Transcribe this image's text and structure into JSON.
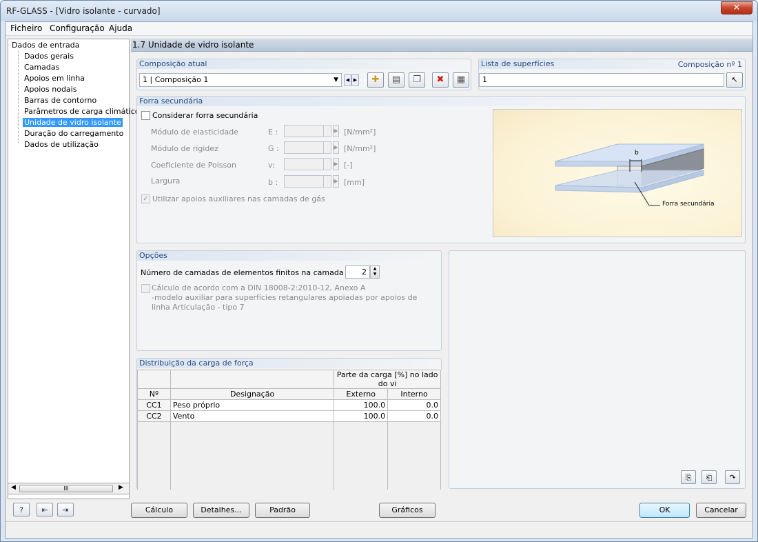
{
  "window": {
    "title": "RF-GLASS - [Vidro isolante - curvado]",
    "close_glyph": "✕"
  },
  "menu": [
    "Ficheiro",
    "Configuração",
    "Ajuda"
  ],
  "tree": {
    "root": "Dados de entrada",
    "items": [
      "Dados gerais",
      "Camadas",
      "Apoios em linha",
      "Apoios nodais",
      "Barras de contorno",
      "Parâmetros de carga climáticos",
      "Unidade de vidro isolante",
      "Duração do carregamento",
      "Dados de utilização"
    ],
    "selected": "Unidade de vidro isolante",
    "scroll_glyph": "III"
  },
  "panel": {
    "title": "1.7 Unidade de vidro isolante"
  },
  "composition": {
    "header": "Composição atual",
    "value": "1 | Composição 1"
  },
  "surfaces": {
    "header": "Lista de superfícies",
    "composition_label": "Composição nº 1",
    "value": "1"
  },
  "secondary_force": {
    "header": "Forra secundária",
    "checkbox": "Considerar forra secundária",
    "fields": [
      {
        "label": "Módulo de elasticidade",
        "symbol": "E :",
        "unit": "[N/mm²]"
      },
      {
        "label": "Módulo de rigidez",
        "symbol": "G :",
        "unit": "[N/mm²]"
      },
      {
        "label": "Coeficiente de Poisson",
        "symbol": "v:",
        "unit": "[-]"
      },
      {
        "label": "Largura",
        "symbol": "b :",
        "unit": "[mm]"
      }
    ],
    "aux_checkbox": "Utilizar apoios auxiliares nas camadas de gás",
    "image_b": "b",
    "image_label": "Forra secundária"
  },
  "options": {
    "header": "Opções",
    "layers_label": "Número de camadas de elementos finitos na camada",
    "layers_value": "2",
    "din_line1": "Cálculo de acordo com a DIN 18008-2:2010-12, Anexo A",
    "din_line2": "-modelo auxiliar para superfícies retangulares apoiadas por apoios de",
    "din_line3": "linha Articulação - tipo 7"
  },
  "distribution": {
    "header": "Distribuição da carga de força",
    "col_no": "Nº",
    "col_desig": "Designação",
    "col_share": "Parte da carga [%] no lado do vi",
    "col_ext": "Externo",
    "col_int": "Interno",
    "rows": [
      {
        "no": "CC1",
        "desig": "Peso próprio",
        "ext": "100.0",
        "int": "0.0"
      },
      {
        "no": "CC2",
        "desig": "Vento",
        "ext": "100.0",
        "int": "0.0"
      }
    ]
  },
  "buttons": {
    "calc": "Cálculo",
    "details": "Detalhes...",
    "default": "Padrão",
    "graphics": "Gráficos",
    "ok": "OK",
    "cancel": "Cancelar"
  },
  "colors": {
    "accent": "#3399ff",
    "header": "#2a4a80"
  }
}
